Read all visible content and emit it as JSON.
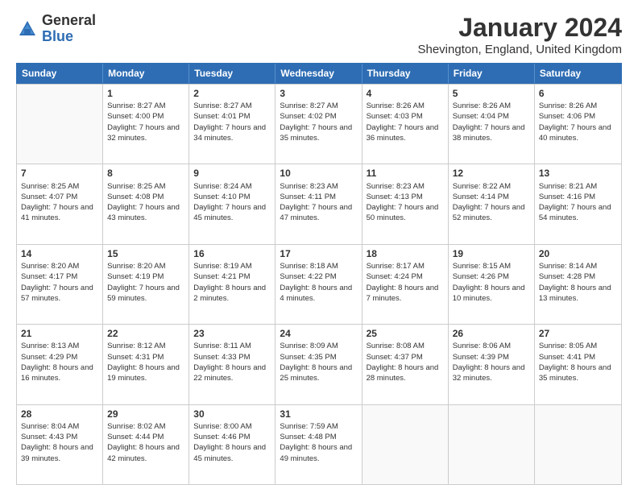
{
  "header": {
    "logo_general": "General",
    "logo_blue": "Blue",
    "month_title": "January 2024",
    "location": "Shevington, England, United Kingdom"
  },
  "days_of_week": [
    "Sunday",
    "Monday",
    "Tuesday",
    "Wednesday",
    "Thursday",
    "Friday",
    "Saturday"
  ],
  "weeks": [
    [
      {
        "day": "",
        "sunrise": "",
        "sunset": "",
        "daylight": ""
      },
      {
        "day": "1",
        "sunrise": "Sunrise: 8:27 AM",
        "sunset": "Sunset: 4:00 PM",
        "daylight": "Daylight: 7 hours and 32 minutes."
      },
      {
        "day": "2",
        "sunrise": "Sunrise: 8:27 AM",
        "sunset": "Sunset: 4:01 PM",
        "daylight": "Daylight: 7 hours and 34 minutes."
      },
      {
        "day": "3",
        "sunrise": "Sunrise: 8:27 AM",
        "sunset": "Sunset: 4:02 PM",
        "daylight": "Daylight: 7 hours and 35 minutes."
      },
      {
        "day": "4",
        "sunrise": "Sunrise: 8:26 AM",
        "sunset": "Sunset: 4:03 PM",
        "daylight": "Daylight: 7 hours and 36 minutes."
      },
      {
        "day": "5",
        "sunrise": "Sunrise: 8:26 AM",
        "sunset": "Sunset: 4:04 PM",
        "daylight": "Daylight: 7 hours and 38 minutes."
      },
      {
        "day": "6",
        "sunrise": "Sunrise: 8:26 AM",
        "sunset": "Sunset: 4:06 PM",
        "daylight": "Daylight: 7 hours and 40 minutes."
      }
    ],
    [
      {
        "day": "7",
        "sunrise": "Sunrise: 8:25 AM",
        "sunset": "Sunset: 4:07 PM",
        "daylight": "Daylight: 7 hours and 41 minutes."
      },
      {
        "day": "8",
        "sunrise": "Sunrise: 8:25 AM",
        "sunset": "Sunset: 4:08 PM",
        "daylight": "Daylight: 7 hours and 43 minutes."
      },
      {
        "day": "9",
        "sunrise": "Sunrise: 8:24 AM",
        "sunset": "Sunset: 4:10 PM",
        "daylight": "Daylight: 7 hours and 45 minutes."
      },
      {
        "day": "10",
        "sunrise": "Sunrise: 8:23 AM",
        "sunset": "Sunset: 4:11 PM",
        "daylight": "Daylight: 7 hours and 47 minutes."
      },
      {
        "day": "11",
        "sunrise": "Sunrise: 8:23 AM",
        "sunset": "Sunset: 4:13 PM",
        "daylight": "Daylight: 7 hours and 50 minutes."
      },
      {
        "day": "12",
        "sunrise": "Sunrise: 8:22 AM",
        "sunset": "Sunset: 4:14 PM",
        "daylight": "Daylight: 7 hours and 52 minutes."
      },
      {
        "day": "13",
        "sunrise": "Sunrise: 8:21 AM",
        "sunset": "Sunset: 4:16 PM",
        "daylight": "Daylight: 7 hours and 54 minutes."
      }
    ],
    [
      {
        "day": "14",
        "sunrise": "Sunrise: 8:20 AM",
        "sunset": "Sunset: 4:17 PM",
        "daylight": "Daylight: 7 hours and 57 minutes."
      },
      {
        "day": "15",
        "sunrise": "Sunrise: 8:20 AM",
        "sunset": "Sunset: 4:19 PM",
        "daylight": "Daylight: 7 hours and 59 minutes."
      },
      {
        "day": "16",
        "sunrise": "Sunrise: 8:19 AM",
        "sunset": "Sunset: 4:21 PM",
        "daylight": "Daylight: 8 hours and 2 minutes."
      },
      {
        "day": "17",
        "sunrise": "Sunrise: 8:18 AM",
        "sunset": "Sunset: 4:22 PM",
        "daylight": "Daylight: 8 hours and 4 minutes."
      },
      {
        "day": "18",
        "sunrise": "Sunrise: 8:17 AM",
        "sunset": "Sunset: 4:24 PM",
        "daylight": "Daylight: 8 hours and 7 minutes."
      },
      {
        "day": "19",
        "sunrise": "Sunrise: 8:15 AM",
        "sunset": "Sunset: 4:26 PM",
        "daylight": "Daylight: 8 hours and 10 minutes."
      },
      {
        "day": "20",
        "sunrise": "Sunrise: 8:14 AM",
        "sunset": "Sunset: 4:28 PM",
        "daylight": "Daylight: 8 hours and 13 minutes."
      }
    ],
    [
      {
        "day": "21",
        "sunrise": "Sunrise: 8:13 AM",
        "sunset": "Sunset: 4:29 PM",
        "daylight": "Daylight: 8 hours and 16 minutes."
      },
      {
        "day": "22",
        "sunrise": "Sunrise: 8:12 AM",
        "sunset": "Sunset: 4:31 PM",
        "daylight": "Daylight: 8 hours and 19 minutes."
      },
      {
        "day": "23",
        "sunrise": "Sunrise: 8:11 AM",
        "sunset": "Sunset: 4:33 PM",
        "daylight": "Daylight: 8 hours and 22 minutes."
      },
      {
        "day": "24",
        "sunrise": "Sunrise: 8:09 AM",
        "sunset": "Sunset: 4:35 PM",
        "daylight": "Daylight: 8 hours and 25 minutes."
      },
      {
        "day": "25",
        "sunrise": "Sunrise: 8:08 AM",
        "sunset": "Sunset: 4:37 PM",
        "daylight": "Daylight: 8 hours and 28 minutes."
      },
      {
        "day": "26",
        "sunrise": "Sunrise: 8:06 AM",
        "sunset": "Sunset: 4:39 PM",
        "daylight": "Daylight: 8 hours and 32 minutes."
      },
      {
        "day": "27",
        "sunrise": "Sunrise: 8:05 AM",
        "sunset": "Sunset: 4:41 PM",
        "daylight": "Daylight: 8 hours and 35 minutes."
      }
    ],
    [
      {
        "day": "28",
        "sunrise": "Sunrise: 8:04 AM",
        "sunset": "Sunset: 4:43 PM",
        "daylight": "Daylight: 8 hours and 39 minutes."
      },
      {
        "day": "29",
        "sunrise": "Sunrise: 8:02 AM",
        "sunset": "Sunset: 4:44 PM",
        "daylight": "Daylight: 8 hours and 42 minutes."
      },
      {
        "day": "30",
        "sunrise": "Sunrise: 8:00 AM",
        "sunset": "Sunset: 4:46 PM",
        "daylight": "Daylight: 8 hours and 45 minutes."
      },
      {
        "day": "31",
        "sunrise": "Sunrise: 7:59 AM",
        "sunset": "Sunset: 4:48 PM",
        "daylight": "Daylight: 8 hours and 49 minutes."
      },
      {
        "day": "",
        "sunrise": "",
        "sunset": "",
        "daylight": ""
      },
      {
        "day": "",
        "sunrise": "",
        "sunset": "",
        "daylight": ""
      },
      {
        "day": "",
        "sunrise": "",
        "sunset": "",
        "daylight": ""
      }
    ]
  ]
}
